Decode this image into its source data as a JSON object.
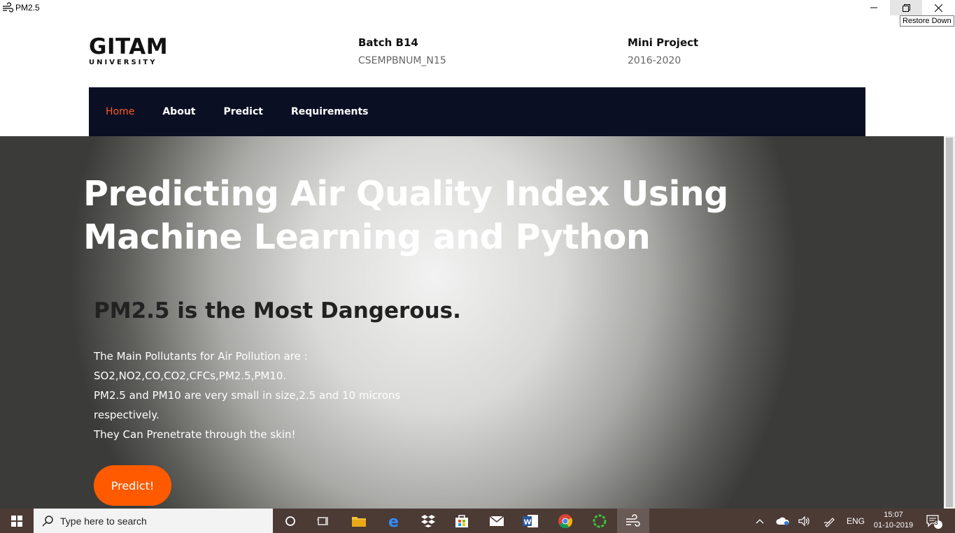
{
  "window": {
    "title": "PM2.5",
    "tooltip": "Restore Down"
  },
  "header": {
    "logo_main": "GITAM",
    "logo_sub": "UNIVERSITY",
    "batch_title": "Batch B14",
    "batch_code": "CSEMPBNUM_N15",
    "project_title": "Mini Project",
    "project_years": "2016-2020"
  },
  "nav": {
    "items": [
      {
        "label": "Home",
        "active": true
      },
      {
        "label": "About"
      },
      {
        "label": "Predict"
      },
      {
        "label": "Requirements"
      }
    ]
  },
  "hero": {
    "title": "Predicting Air Quality Index Using Machine Learning and Python",
    "subtitle": "PM2.5 is the Most Dangerous.",
    "lines": [
      "The Main Pollutants for Air Pollution are :",
      "SO2,NO2,CO,CO2,CFCs,PM2.5,PM10.",
      "PM2.5 and PM10 are very small in size,2.5 and 10 microns respectively.",
      "They Can Prenetrate through the skin!"
    ],
    "button_label": "Predict!"
  },
  "taskbar": {
    "search_placeholder": "Type here to search",
    "language": "ENG",
    "time": "15:07",
    "date": "01-10-2019",
    "notification_count": "3"
  },
  "colors": {
    "accent": "#ff5a00",
    "nav_bg": "#0b0f24",
    "taskbar_bg": "#4c3a34"
  }
}
